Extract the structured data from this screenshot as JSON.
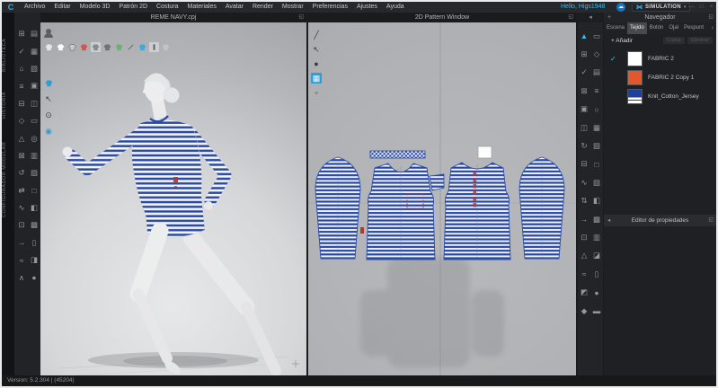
{
  "app": {
    "logo_letter": "C",
    "greeting": "Hello, Higs1948",
    "simulation_label": "SIMULATION",
    "version": "Version: 5.2.304 | (45204)"
  },
  "menu": {
    "items": [
      "Archivo",
      "Editar",
      "Modelo 3D",
      "Patrón 2D",
      "Costura",
      "Materiales",
      "Avatar",
      "Render",
      "Mostrar",
      "Preferencias",
      "Ajustes",
      "Ayuda"
    ]
  },
  "windows": {
    "view3d_title": "REME NAVY.cpj",
    "view2d_title": "2D Pattern Window"
  },
  "sidebar": {
    "labels": [
      "BIBLIOTECA",
      "HISTORIA",
      "CONFIGURADOR MODULAR"
    ]
  },
  "navigator": {
    "title": "Navegador",
    "tabs": [
      "Escena",
      "Tejido",
      "Botón",
      "Ojal",
      "Pespunt"
    ],
    "active_tab": "Tejido",
    "add_label": "+ Añadir",
    "copy_label": "Copiar",
    "delete_label": "Eliminar",
    "fabrics": [
      {
        "name": "FABRIC 2",
        "swatch": "#ffffff",
        "checked": true
      },
      {
        "name": "FABRIC 2 Copy 1",
        "swatch": "#e2572b",
        "checked": false
      },
      {
        "name": "Knit_Cotton_Jersey",
        "swatch": "#20409f",
        "checked": false
      }
    ],
    "properties_title": "Editor de propiedades"
  },
  "icons": {
    "check": "✓",
    "plus_small": "+",
    "collapse": "◂",
    "overflow": "›",
    "detach": "◱",
    "caret": "▾",
    "cloud": "☁",
    "sim_logo": "⋈",
    "win_min": "—",
    "win_max": "□",
    "win_close": "×"
  },
  "colors": {
    "accent_blue": "#3db9ea",
    "stripe_navy": "#2747a8",
    "fabric_orange": "#e2572b",
    "mark_red": "#b8352c"
  },
  "icon_grids": {
    "sidebar": [
      "⊞",
      "▤",
      "✓",
      "▦",
      "⌂",
      "▧",
      "≡",
      "▣",
      "⊟",
      "◫",
      "◇",
      "▭",
      "△",
      "◎",
      "⊠",
      "▥",
      "↺",
      "▨",
      "⇄",
      "□",
      "∿",
      "◧",
      "⊡",
      "▩",
      "→",
      "▯",
      "≈",
      "◨",
      "∧",
      "●"
    ],
    "pattern_tools": [
      "▲",
      "▭",
      "⊞",
      "◇",
      "✓",
      "▤",
      "⊠",
      "≡",
      "▣",
      "○",
      "◫",
      "▦",
      "↻",
      "▧",
      "⊟",
      "□",
      "∿",
      "▨",
      "⇅",
      "◧",
      "→",
      "▩",
      "⊡",
      "▥",
      "△",
      "◪",
      "≈",
      "▯",
      "◩",
      "●",
      "◆",
      "▬"
    ]
  }
}
